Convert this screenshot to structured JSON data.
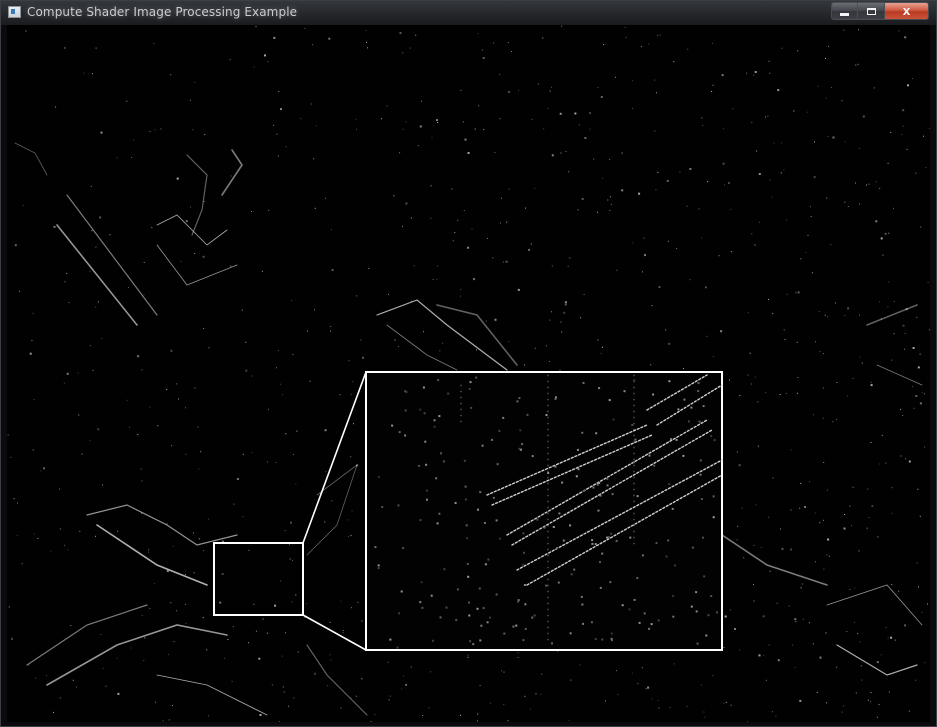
{
  "window": {
    "title": "Compute Shader Image Processing Example",
    "controls": {
      "minimize_icon": "minimize-icon",
      "maximize_icon": "maximize-icon",
      "close_icon": "close-icon",
      "close_glyph": "x"
    }
  },
  "viewport": {
    "content": "edge-detected image with magnified inset",
    "colors": {
      "background": "#010101",
      "edges": "#d8d8d8",
      "inset_frame": "#ffffff"
    }
  }
}
